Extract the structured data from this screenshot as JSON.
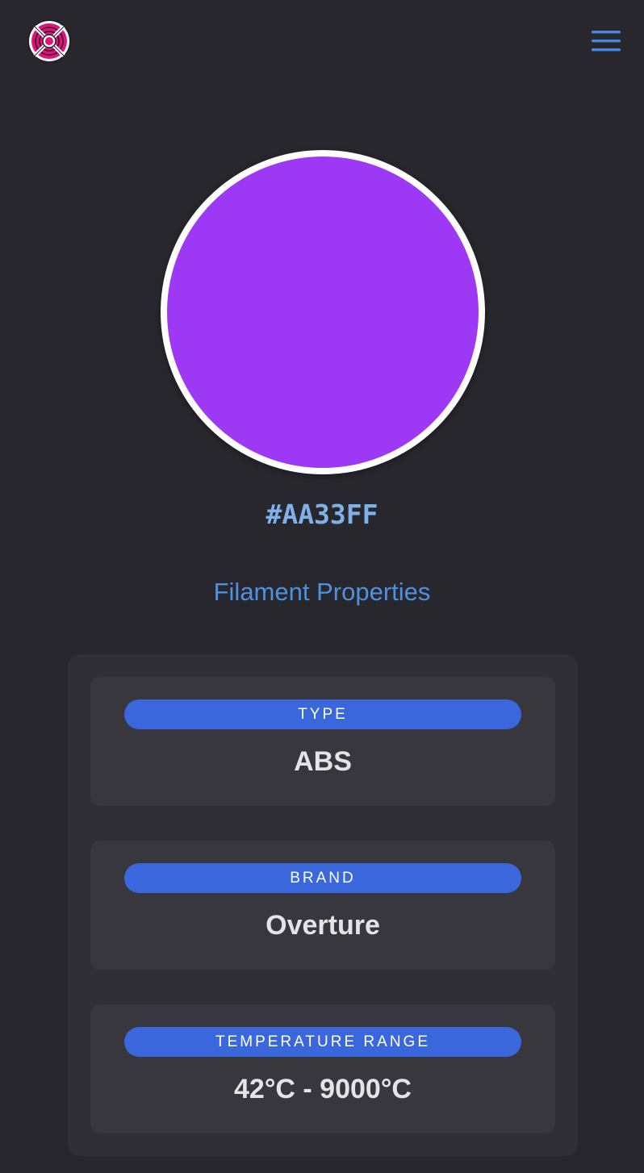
{
  "header": {
    "logo_icon": "fan-logo-icon",
    "menu_icon": "hamburger-menu-icon"
  },
  "swatch": {
    "color": "#9d38f5",
    "hex_label": "#AA33FF"
  },
  "properties": {
    "title": "Filament Properties",
    "items": [
      {
        "label": "TYPE",
        "value": "ABS"
      },
      {
        "label": "BRAND",
        "value": "Overture"
      },
      {
        "label": "TEMPERATURE RANGE",
        "value": "42°C - 9000°C"
      }
    ]
  },
  "colors": {
    "background": "#27272d",
    "panel": "#2f2f35",
    "card": "#37373d",
    "accent": "#3a68dc",
    "title_blue": "#4e91df",
    "hex_blue": "#7fb0e8"
  }
}
